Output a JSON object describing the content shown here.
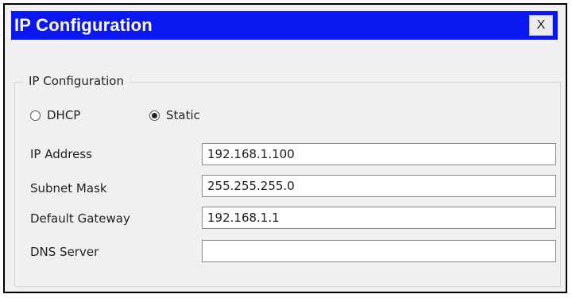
{
  "window": {
    "title": "IP Configuration",
    "close_label": "X"
  },
  "group": {
    "legend": "IP Configuration"
  },
  "mode": {
    "options": [
      {
        "label": "DHCP",
        "selected": false
      },
      {
        "label": "Static",
        "selected": true
      }
    ]
  },
  "fields": {
    "ip_address": {
      "label": "IP Address",
      "value": "192.168.1.100"
    },
    "subnet_mask": {
      "label": "Subnet Mask",
      "value": "255.255.255.0"
    },
    "default_gateway": {
      "label": "Default Gateway",
      "value": "192.168.1.1"
    },
    "dns_server": {
      "label": "DNS Server",
      "value": ""
    }
  },
  "colors": {
    "titlebar": "#0a17f0",
    "window_bg": "#f0f0f0"
  }
}
